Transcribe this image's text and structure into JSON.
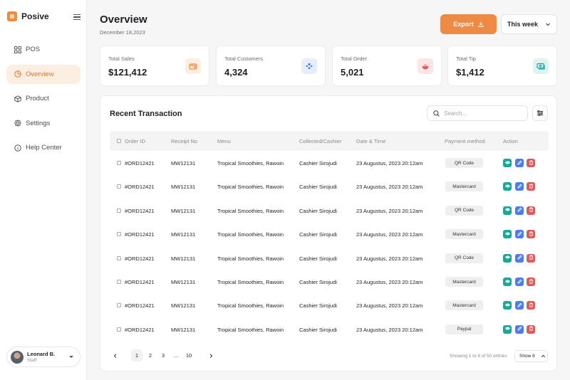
{
  "app": {
    "name": "Posive"
  },
  "sidebar": {
    "items": [
      {
        "label": "POS",
        "icon": "grid-icon",
        "active": false
      },
      {
        "label": "Overview",
        "icon": "overview-icon",
        "active": true
      },
      {
        "label": "Product",
        "icon": "box-icon",
        "active": false
      },
      {
        "label": "Settings",
        "icon": "gear-icon",
        "active": false
      },
      {
        "label": "Help Center",
        "icon": "info-icon",
        "active": false
      }
    ],
    "user": {
      "name": "Leonard B.",
      "role": "Staff"
    }
  },
  "header": {
    "title": "Overview",
    "date": "December 18,2023",
    "export_label": "Export",
    "range_label": "This week"
  },
  "stats": [
    {
      "label": "Total Sales",
      "value": "$121,412",
      "icon": "wallet-icon",
      "color": "#f08a3c",
      "bg": "#fdeee2"
    },
    {
      "label": "Total Customers",
      "value": "4,324",
      "icon": "people-icon",
      "color": "#4b7df0",
      "bg": "#e6eefc"
    },
    {
      "label": "Total Order",
      "value": "5,021",
      "icon": "bowl-icon",
      "color": "#e05a5a",
      "bg": "#fbe5e5"
    },
    {
      "label": "Total Tip",
      "value": "$1,412",
      "icon": "cash-icon",
      "color": "#1aa89b",
      "bg": "#ddf4f1"
    }
  ],
  "transactions": {
    "title": "Recent Transaction",
    "search_placeholder": "Search...",
    "columns": [
      "Order ID",
      "Receipt No",
      "Menu",
      "Collected/Cashier",
      "Date & Time",
      "Payment method",
      "Action"
    ],
    "rows": [
      {
        "order_id": "#ORD12421",
        "receipt": "MW12131",
        "menu": "Tropical Smoothies, Rawoin",
        "cashier": "Cashier Sirojudi",
        "datetime": "23 Augustus, 2023 20:12am",
        "payment": "QR Code"
      },
      {
        "order_id": "#ORD12421",
        "receipt": "MW12131",
        "menu": "Tropical Smoothies, Rawoin",
        "cashier": "Cashier Sirojudi",
        "datetime": "23 Augustus, 2023 20:12am",
        "payment": "Mastercard"
      },
      {
        "order_id": "#ORD12421",
        "receipt": "MW12131",
        "menu": "Tropical Smoothies, Rawoin",
        "cashier": "Cashier Sirojudi",
        "datetime": "23 Augustus, 2023 20:12am",
        "payment": "QR Code"
      },
      {
        "order_id": "#ORD12421",
        "receipt": "MW12131",
        "menu": "Tropical Smoothies, Rawoin",
        "cashier": "Cashier Sirojudi",
        "datetime": "23 Augustus, 2023 20:12am",
        "payment": "Mastercard"
      },
      {
        "order_id": "#ORD12421",
        "receipt": "MW12131",
        "menu": "Tropical Smoothies, Rawoin",
        "cashier": "Cashier Sirojudi",
        "datetime": "23 Augustus, 2023 20:12am",
        "payment": "QR Code"
      },
      {
        "order_id": "#ORD12421",
        "receipt": "MW12131",
        "menu": "Tropical Smoothies, Rawoin",
        "cashier": "Cashier Sirojudi",
        "datetime": "23 Augustus, 2023 20:12am",
        "payment": "Mastercard"
      },
      {
        "order_id": "#ORD12421",
        "receipt": "MW12131",
        "menu": "Tropical Smoothies, Rawoin",
        "cashier": "Cashier Sirojudi",
        "datetime": "23 Augustus, 2023 20:12am",
        "payment": "Mastercard"
      },
      {
        "order_id": "#ORD12421",
        "receipt": "MW12131",
        "menu": "Tropical Smoothies, Rawoin",
        "cashier": "Cashier Sirojudi",
        "datetime": "23 Augustus, 2023 20:12am",
        "payment": "Paypal"
      }
    ]
  },
  "pagination": {
    "pages": [
      "1",
      "2",
      "3",
      "...",
      "10"
    ],
    "current": "1",
    "showing": "Showing 1 to 8 of 50 entries",
    "show_label": "Show 8"
  },
  "colors": {
    "accent": "#ee8a44",
    "view": "#1aa89b",
    "edit": "#4b7df0",
    "delete": "#e05a5a"
  }
}
